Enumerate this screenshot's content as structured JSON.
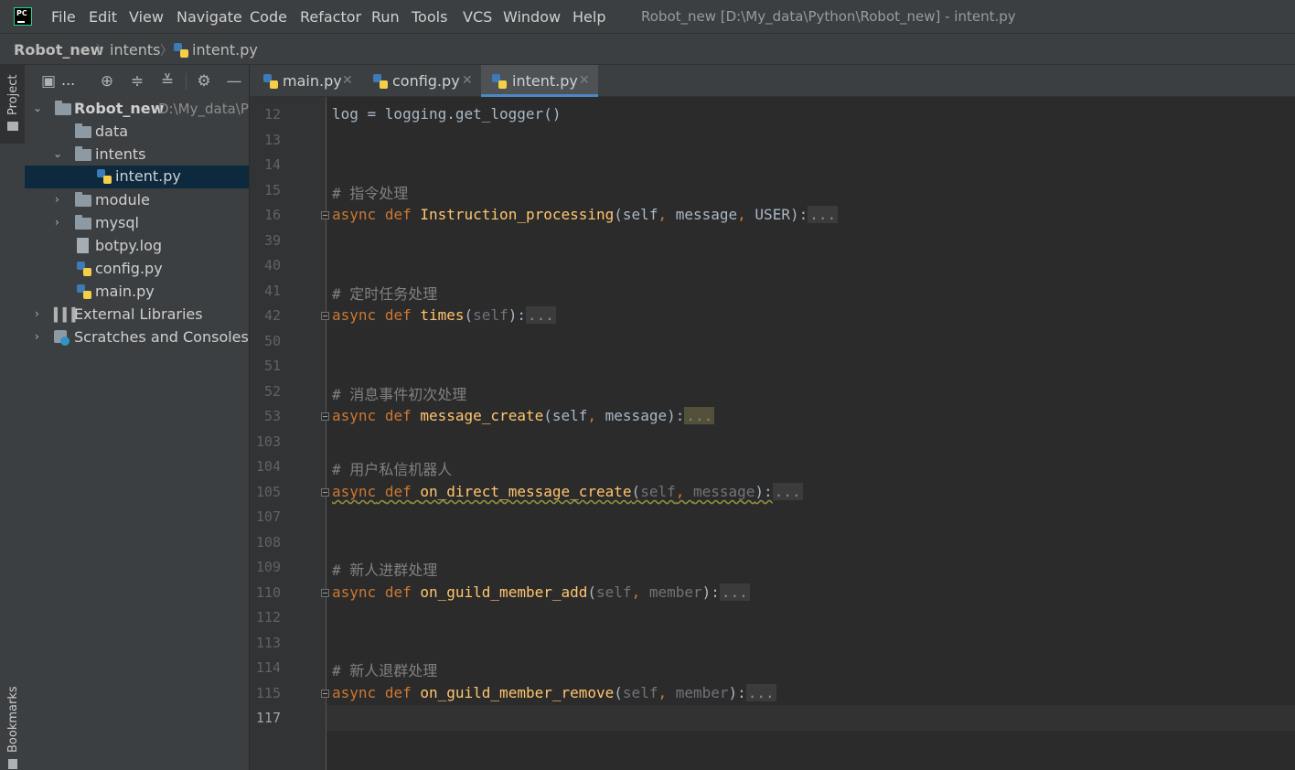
{
  "app": {
    "logo_text": "PC",
    "window_title": "Robot_new [D:\\My_data\\Python\\Robot_new] - intent.py"
  },
  "menu": [
    "File",
    "Edit",
    "View",
    "Navigate",
    "Code",
    "Refactor",
    "Run",
    "Tools",
    "VCS",
    "Window",
    "Help"
  ],
  "breadcrumb": [
    "Robot_new",
    "intents",
    "intent.py"
  ],
  "side_strip": {
    "project_label": "Project",
    "bookmarks_label": "Bookmarks"
  },
  "project_panel": {
    "view_label": "...",
    "tree": [
      {
        "label": "Robot_new",
        "path": "D:\\My_data\\P",
        "type": "folder",
        "expanded": true,
        "bold": true
      },
      {
        "label": "data",
        "type": "folder"
      },
      {
        "label": "intents",
        "type": "folder",
        "expanded": true
      },
      {
        "label": "intent.py",
        "type": "py",
        "selected": true
      },
      {
        "label": "module",
        "type": "folder",
        "expanded": false
      },
      {
        "label": "mysql",
        "type": "folder",
        "expanded": false
      },
      {
        "label": "botpy.log",
        "type": "file"
      },
      {
        "label": "config.py",
        "type": "py"
      },
      {
        "label": "main.py",
        "type": "py"
      },
      {
        "label": "External Libraries",
        "type": "lib",
        "expanded": false
      },
      {
        "label": "Scratches and Consoles",
        "type": "scratch",
        "expanded": false
      }
    ]
  },
  "tabs": [
    {
      "label": "main.py",
      "active": false
    },
    {
      "label": "config.py",
      "active": false
    },
    {
      "label": "intent.py",
      "active": true
    }
  ],
  "editor": {
    "current_line": "117",
    "lines": [
      {
        "n": "12",
        "code": "log = logging.get_logger()"
      },
      {
        "n": "13",
        "code": ""
      },
      {
        "n": "14",
        "code": ""
      },
      {
        "n": "15",
        "code": "# 指令处理"
      },
      {
        "n": "16",
        "code": "async def Instruction_processing(self, message, USER):..."
      },
      {
        "n": "39",
        "code": ""
      },
      {
        "n": "40",
        "code": ""
      },
      {
        "n": "41",
        "code": "# 定时任务处理"
      },
      {
        "n": "42",
        "code": "async def times(self):..."
      },
      {
        "n": "50",
        "code": ""
      },
      {
        "n": "51",
        "code": ""
      },
      {
        "n": "52",
        "code": "# 消息事件初次处理"
      },
      {
        "n": "53",
        "code": "async def message_create(self, message):..."
      },
      {
        "n": "103",
        "code": ""
      },
      {
        "n": "104",
        "code": "# 用户私信机器人"
      },
      {
        "n": "105",
        "code": "async def on_direct_message_create(self, message):..."
      },
      {
        "n": "107",
        "code": ""
      },
      {
        "n": "108",
        "code": ""
      },
      {
        "n": "109",
        "code": "# 新人进群处理"
      },
      {
        "n": "110",
        "code": "async def on_guild_member_add(self, member):..."
      },
      {
        "n": "112",
        "code": ""
      },
      {
        "n": "113",
        "code": ""
      },
      {
        "n": "114",
        "code": "# 新人退群处理"
      },
      {
        "n": "115",
        "code": "async def on_guild_member_remove(self, member):..."
      },
      {
        "n": "117",
        "code": ""
      }
    ],
    "tokens": {
      "kw_async": "async",
      "kw_def": "def",
      "comma": ", ",
      "dots": "...",
      "colon": ")",
      "l12_a": "log = logging.get_logger()",
      "c15": "# 指令处理",
      "f16": "Instruction_processing",
      "p16a": "(self",
      "p16b": "message",
      "p16c": "USER):",
      "c41": "# 定时任务处理",
      "f42": "times",
      "p42a": "(",
      "p42b": "self",
      "p42c": "):",
      "c52": "# 消息事件初次处理",
      "f53": "message_create",
      "p53a": "(self",
      "p53b": "message):",
      "c104": "# 用户私信机器人",
      "f105": "on_direct_message_create",
      "p105a": "(",
      "p105b": "self",
      "p105c": "message",
      "p105d": "):",
      "c109": "# 新人进群处理",
      "f110": "on_guild_member_add",
      "p110a": "(",
      "p110b": "self",
      "p110c": "member",
      "p110d": "):",
      "c114": "# 新人退群处理",
      "f115": "on_guild_member_remove",
      "p115a": "(",
      "p115b": "self",
      "p115c": "member",
      "p115d": "):"
    }
  },
  "colors": {
    "keyword": "#cc7832",
    "function": "#ffc66d",
    "plain": "#a9b7c6",
    "comment": "#808080",
    "selection": "#0d293e",
    "tab_underline": "#4a88c7"
  }
}
